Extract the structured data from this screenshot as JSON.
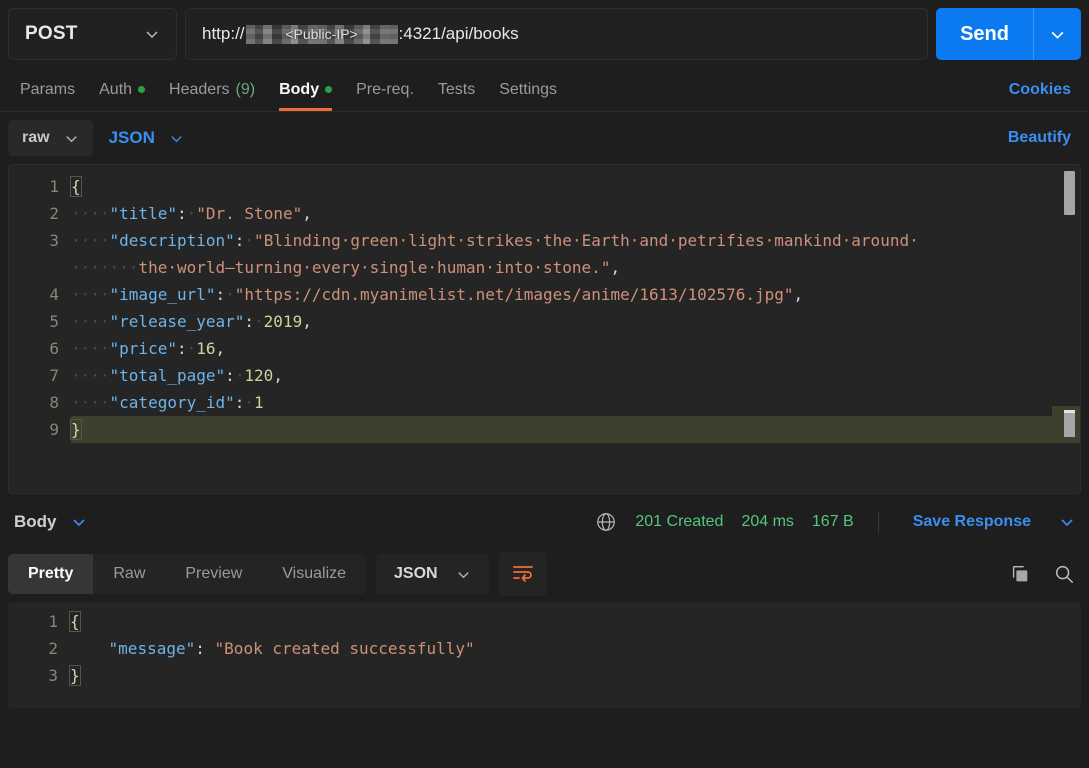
{
  "request": {
    "method": "POST",
    "url": {
      "prefix": "http://",
      "redacted_label": "<Public-IP>",
      "suffix": ":4321/api/books"
    },
    "send_label": "Send",
    "tabs": [
      {
        "label": "Params",
        "dot": false,
        "count": "",
        "active": false
      },
      {
        "label": "Auth",
        "dot": true,
        "count": "",
        "active": false
      },
      {
        "label": "Headers",
        "dot": false,
        "count": "(9)",
        "active": false
      },
      {
        "label": "Body",
        "dot": true,
        "count": "",
        "active": true
      },
      {
        "label": "Pre-req.",
        "dot": false,
        "count": "",
        "active": false
      },
      {
        "label": "Tests",
        "dot": false,
        "count": "",
        "active": false
      },
      {
        "label": "Settings",
        "dot": false,
        "count": "",
        "active": false
      }
    ],
    "cookies_label": "Cookies",
    "body_mode": "raw",
    "body_language": "JSON",
    "beautify_label": "Beautify",
    "body_json": {
      "title": "Dr. Stone",
      "description": "Blinding green light strikes the Earth and petrifies mankind around the world—turning every single human into stone.",
      "image_url": "https://cdn.myanimelist.net/images/anime/1613/102576.jpg",
      "release_year": "2019",
      "price": "16",
      "total_page": "120",
      "category_id": "1"
    },
    "line_numbers": [
      "1",
      "2",
      "3",
      "",
      "4",
      "5",
      "6",
      "7",
      "8",
      "9"
    ]
  },
  "response": {
    "body_label": "Body",
    "status_code": "201 Created",
    "time": "204 ms",
    "size": "167 B",
    "save_response_label": "Save Response",
    "tabs": [
      {
        "label": "Pretty",
        "active": true
      },
      {
        "label": "Raw",
        "active": false
      },
      {
        "label": "Preview",
        "active": false
      },
      {
        "label": "Visualize",
        "active": false
      }
    ],
    "language": "JSON",
    "line_numbers": [
      "1",
      "2",
      "3"
    ],
    "body_json": {
      "message_key": "message",
      "message_value": "Book created successfully"
    }
  },
  "colors": {
    "accent_orange": "#ef6c3d",
    "link_blue": "#3a8ff1",
    "send_blue": "#0b79f0",
    "status_green": "#53c77f",
    "dot_green": "#2aa147"
  }
}
